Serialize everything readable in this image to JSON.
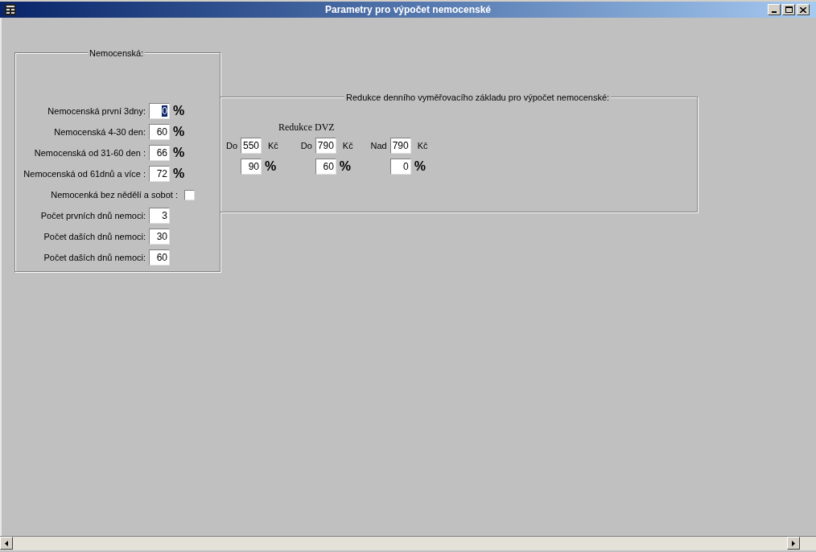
{
  "window": {
    "title": "Parametry pro výpočet nemocenské"
  },
  "sick_pay_group": {
    "title": "Nemocenská:",
    "rows": [
      {
        "kind": "percent",
        "label": "Nemocenská první 3dny:",
        "value": "0",
        "focused": true,
        "unit": "%"
      },
      {
        "kind": "percent",
        "label": "Nemocenská 4-30 den:",
        "value": "60",
        "focused": false,
        "unit": "%"
      },
      {
        "kind": "percent",
        "label": "Nemocenská od 31-60 den :",
        "value": "66",
        "focused": false,
        "unit": "%"
      },
      {
        "kind": "percent",
        "label": "Nemocenská od 61dnů a více :",
        "value": "72",
        "focused": false,
        "unit": "%"
      },
      {
        "kind": "checkbox",
        "label": "Nemocenká bez nědělí a sobot :",
        "checked": false
      },
      {
        "kind": "number",
        "label": "Počet prvních dnů nemoci:",
        "value": "3",
        "focused": false
      },
      {
        "kind": "number",
        "label": "Počet daších dnů nemoci:",
        "value": "30",
        "focused": false
      },
      {
        "kind": "number",
        "label": "Počet daších dnů nemoci:",
        "value": "60",
        "focused": false
      }
    ]
  },
  "reduction_group": {
    "title": "Redukce denního vyměřovacího základu pro výpočet nemocenské:",
    "subtitle": "Redukce DVZ",
    "brackets": [
      {
        "prefix": "Do",
        "limit": "550",
        "currency": "Kč",
        "rate": "90",
        "unit": "%"
      },
      {
        "prefix": "Do",
        "limit": "790",
        "currency": "Kč",
        "rate": "60",
        "unit": "%"
      },
      {
        "prefix": "Nad",
        "limit": "790",
        "currency": "Kč",
        "rate": "0",
        "unit": "%"
      }
    ]
  }
}
